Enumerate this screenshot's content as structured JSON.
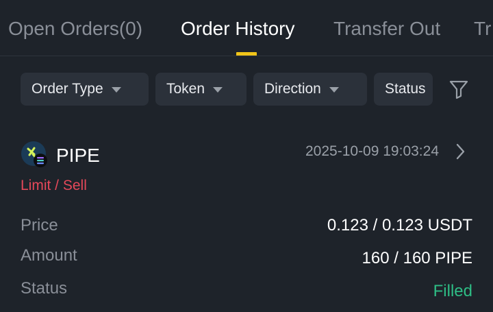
{
  "tabs": [
    {
      "label": "Open Orders(0)",
      "active": false
    },
    {
      "label": "Order History",
      "active": true
    },
    {
      "label": "Transfer Out",
      "active": false
    },
    {
      "label": "Tr",
      "active": false
    }
  ],
  "filters": [
    {
      "label": "Order Type",
      "icon": "chevron-down-icon"
    },
    {
      "label": "Token",
      "icon": "chevron-down-icon"
    },
    {
      "label": "Direction",
      "icon": "chevron-down-icon"
    },
    {
      "label": "Status"
    }
  ],
  "filter_button_icon": "funnel-icon",
  "order": {
    "token": "PIPE",
    "time": "2025-10-09 19:03:24",
    "side": "Limit / Sell",
    "rows": [
      {
        "label": "Price",
        "value": "0.123 / 0.123 USDT"
      },
      {
        "label": "Amount",
        "value": "160 / 160 PIPE"
      },
      {
        "label": "Status",
        "value": "Filled"
      }
    ]
  },
  "colors": {
    "background": "#1e232a",
    "accent": "#f0c419",
    "sell": "#e5485a",
    "filled": "#2ebd85",
    "chip": "#2b313a"
  }
}
